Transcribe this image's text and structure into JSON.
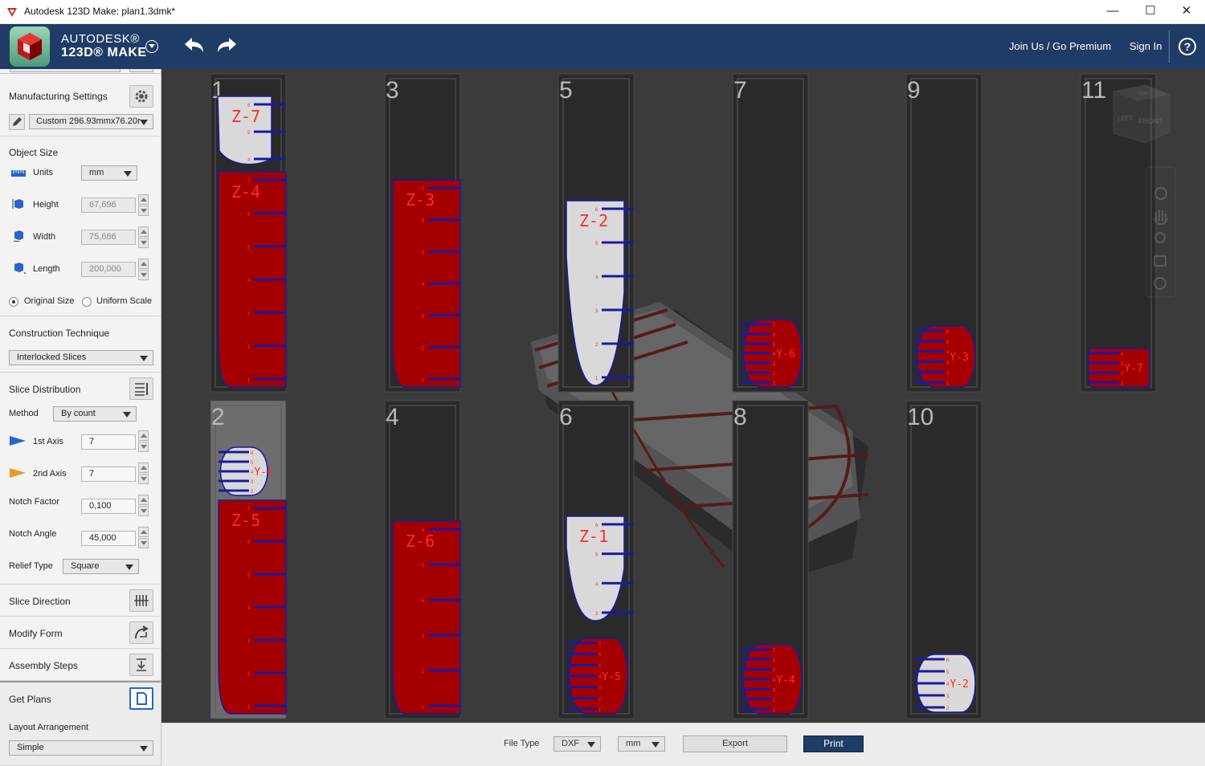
{
  "window": {
    "title": "Autodesk 123D Make: plan1.3dmk*",
    "minimize": "—",
    "maximize": "☐",
    "close": "✕"
  },
  "header": {
    "brand_top": "AUTODESK®",
    "brand_bottom": "123D® MAKE",
    "join": "Join Us / Go Premium",
    "signin": "Sign In",
    "help": "?"
  },
  "panel": {
    "manufacturing": {
      "title": "Manufacturing Settings",
      "preset": "Custom 296.93mmx76.20r"
    },
    "object_size": {
      "title": "Object Size",
      "units_label": "Units",
      "units_value": "mm",
      "height_label": "Height",
      "height_value": "67,696",
      "width_label": "Width",
      "width_value": "75,686",
      "length_label": "Length",
      "length_value": "200,000",
      "original_size": "Original Size",
      "uniform_scale": "Uniform Scale"
    },
    "construction": {
      "title": "Construction Technique",
      "technique": "Interlocked Slices"
    },
    "slice_distribution": {
      "title": "Slice Distribution",
      "method_label": "Method",
      "method_value": "By count",
      "axis1_label": "1st Axis",
      "axis1_value": "7",
      "axis2_label": "2nd Axis",
      "axis2_value": "7",
      "notch_factor_label": "Notch Factor",
      "notch_factor_value": "0,100",
      "notch_angle_label": "Notch Angle",
      "notch_angle_value": "45,000",
      "relief_label": "Relief Type",
      "relief_value": "Square"
    },
    "slice_direction": "Slice Direction",
    "modify_form": "Modify Form",
    "assembly_steps": "Assembly Steps",
    "get_plans": {
      "title": "Get Plans",
      "layout_label": "Layout Arrangement",
      "layout_value": "Simple"
    }
  },
  "viewcube": {
    "top": "TOP",
    "left": "LEFT",
    "front": "FRONT"
  },
  "sheets": [
    {
      "number": "1",
      "parts": [
        {
          "label": "Z-7",
          "fill": "#d9d9d9",
          "notches": 3,
          "marks": [
            "6",
            "5",
            "4"
          ]
        },
        {
          "label": "Z-4",
          "fill": "#a50000",
          "notches": 7,
          "marks": [
            "7",
            "6",
            "5",
            "4",
            "3",
            "2",
            "1"
          ]
        }
      ]
    },
    {
      "number": "3",
      "parts": [
        {
          "label": "Z-3",
          "fill": "#a50000",
          "notches": 7,
          "marks": [
            "7",
            "6",
            "5",
            "4",
            "3",
            "2",
            "1"
          ]
        }
      ]
    },
    {
      "number": "5",
      "parts": [
        {
          "label": "Z-2",
          "fill": "#d9d9d9",
          "notches": 6,
          "marks": [
            "6",
            "5",
            "4",
            "3",
            "2",
            "1"
          ]
        }
      ]
    },
    {
      "number": "7",
      "parts": [
        {
          "label": "Y-6",
          "fill": "#a50000",
          "notches": 7,
          "marks": [
            "7",
            "6",
            "5",
            "4",
            "3",
            "2",
            "1"
          ]
        }
      ]
    },
    {
      "number": "9",
      "parts": [
        {
          "label": "Y-3",
          "fill": "#a50000",
          "notches": 6,
          "marks": [
            "6",
            "5",
            "4",
            "3",
            "2",
            "1"
          ]
        }
      ]
    },
    {
      "number": "11",
      "parts": [
        {
          "label": "Y-7",
          "fill": "#a50000",
          "notches": 4,
          "marks": [
            "4",
            "3",
            "2",
            "1"
          ]
        }
      ]
    },
    {
      "number": "2",
      "parts": [
        {
          "label": "Y-1",
          "fill": "#d9d9d9",
          "notches": 5,
          "marks": [
            "6",
            "5",
            "4",
            "3",
            "2"
          ]
        },
        {
          "label": "Z-5",
          "fill": "#a50000",
          "notches": 7,
          "marks": [
            "7",
            "6",
            "5",
            "4",
            "3",
            "2",
            "1"
          ]
        }
      ]
    },
    {
      "number": "4",
      "parts": [
        {
          "label": "Z-6",
          "fill": "#a50000",
          "notches": 6,
          "marks": [
            "6",
            "5",
            "4",
            "3",
            "2",
            "1"
          ]
        }
      ]
    },
    {
      "number": "6",
      "parts": [
        {
          "label": "Z-1",
          "fill": "#d9d9d9",
          "notches": 4,
          "marks": [
            "6",
            "5",
            "4",
            "3"
          ]
        },
        {
          "label": "Y-5",
          "fill": "#a50000",
          "notches": 7,
          "marks": [
            "7",
            "6",
            "5",
            "4",
            "3",
            "2",
            "1"
          ]
        }
      ]
    },
    {
      "number": "8",
      "parts": [
        {
          "label": "Y-4",
          "fill": "#a50000",
          "notches": 7,
          "marks": [
            "7",
            "6",
            "5",
            "4",
            "3",
            "2",
            "1"
          ]
        }
      ]
    },
    {
      "number": "10",
      "parts": [
        {
          "label": "Y-2",
          "fill": "#d9d9d9",
          "notches": 5,
          "marks": [
            "6",
            "5",
            "4",
            "3",
            "2"
          ]
        }
      ]
    }
  ],
  "bottom_bar": {
    "file_type_label": "File Type",
    "file_type": "DXF",
    "units": "mm",
    "export": "Export",
    "print": "Print"
  },
  "colors": {
    "header": "#1f3c66",
    "part_red": "#a50000",
    "part_grey": "#d9d9d9",
    "notch_blue": "#1a1aa0",
    "label_red": "#ff2a2a",
    "viewport": "#3b3b3b"
  }
}
